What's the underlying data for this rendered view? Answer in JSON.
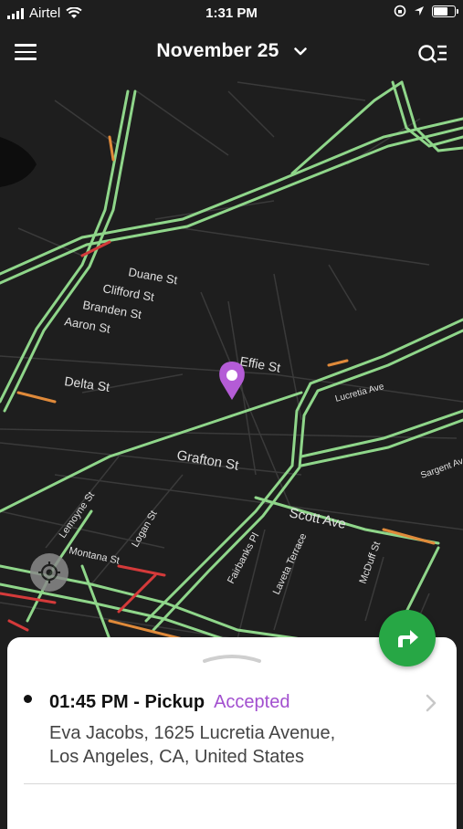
{
  "status_bar": {
    "carrier": "Airtel",
    "time": "1:31 PM"
  },
  "header": {
    "date": "November 25"
  },
  "map": {
    "street_labels": [
      "Duane St",
      "Clifford St",
      "Branden St",
      "Aaron St",
      "Delta St",
      "Effie St",
      "Grafton St",
      "Scott Ave",
      "Lemoyne St",
      "Logan St",
      "Fairbanks Pl",
      "Laveta Terrace",
      "McDuff St",
      "Lucretia Ave",
      "Montana St",
      "Sargent Ave"
    ],
    "colors": {
      "background": "#1e1e1e",
      "road": "#3a3a3a",
      "traffic_free": "#8fd68a",
      "traffic_moderate": "#e08a3a",
      "traffic_heavy": "#d43a3a",
      "pin": "#b45cd6"
    }
  },
  "stop": {
    "time": "01:45 PM",
    "type": "Pickup",
    "status": "Accepted",
    "address_line1": "Eva Jacobs, 1625 Lucretia Avenue,",
    "address_line2": "Los Angeles, CA, United States"
  }
}
